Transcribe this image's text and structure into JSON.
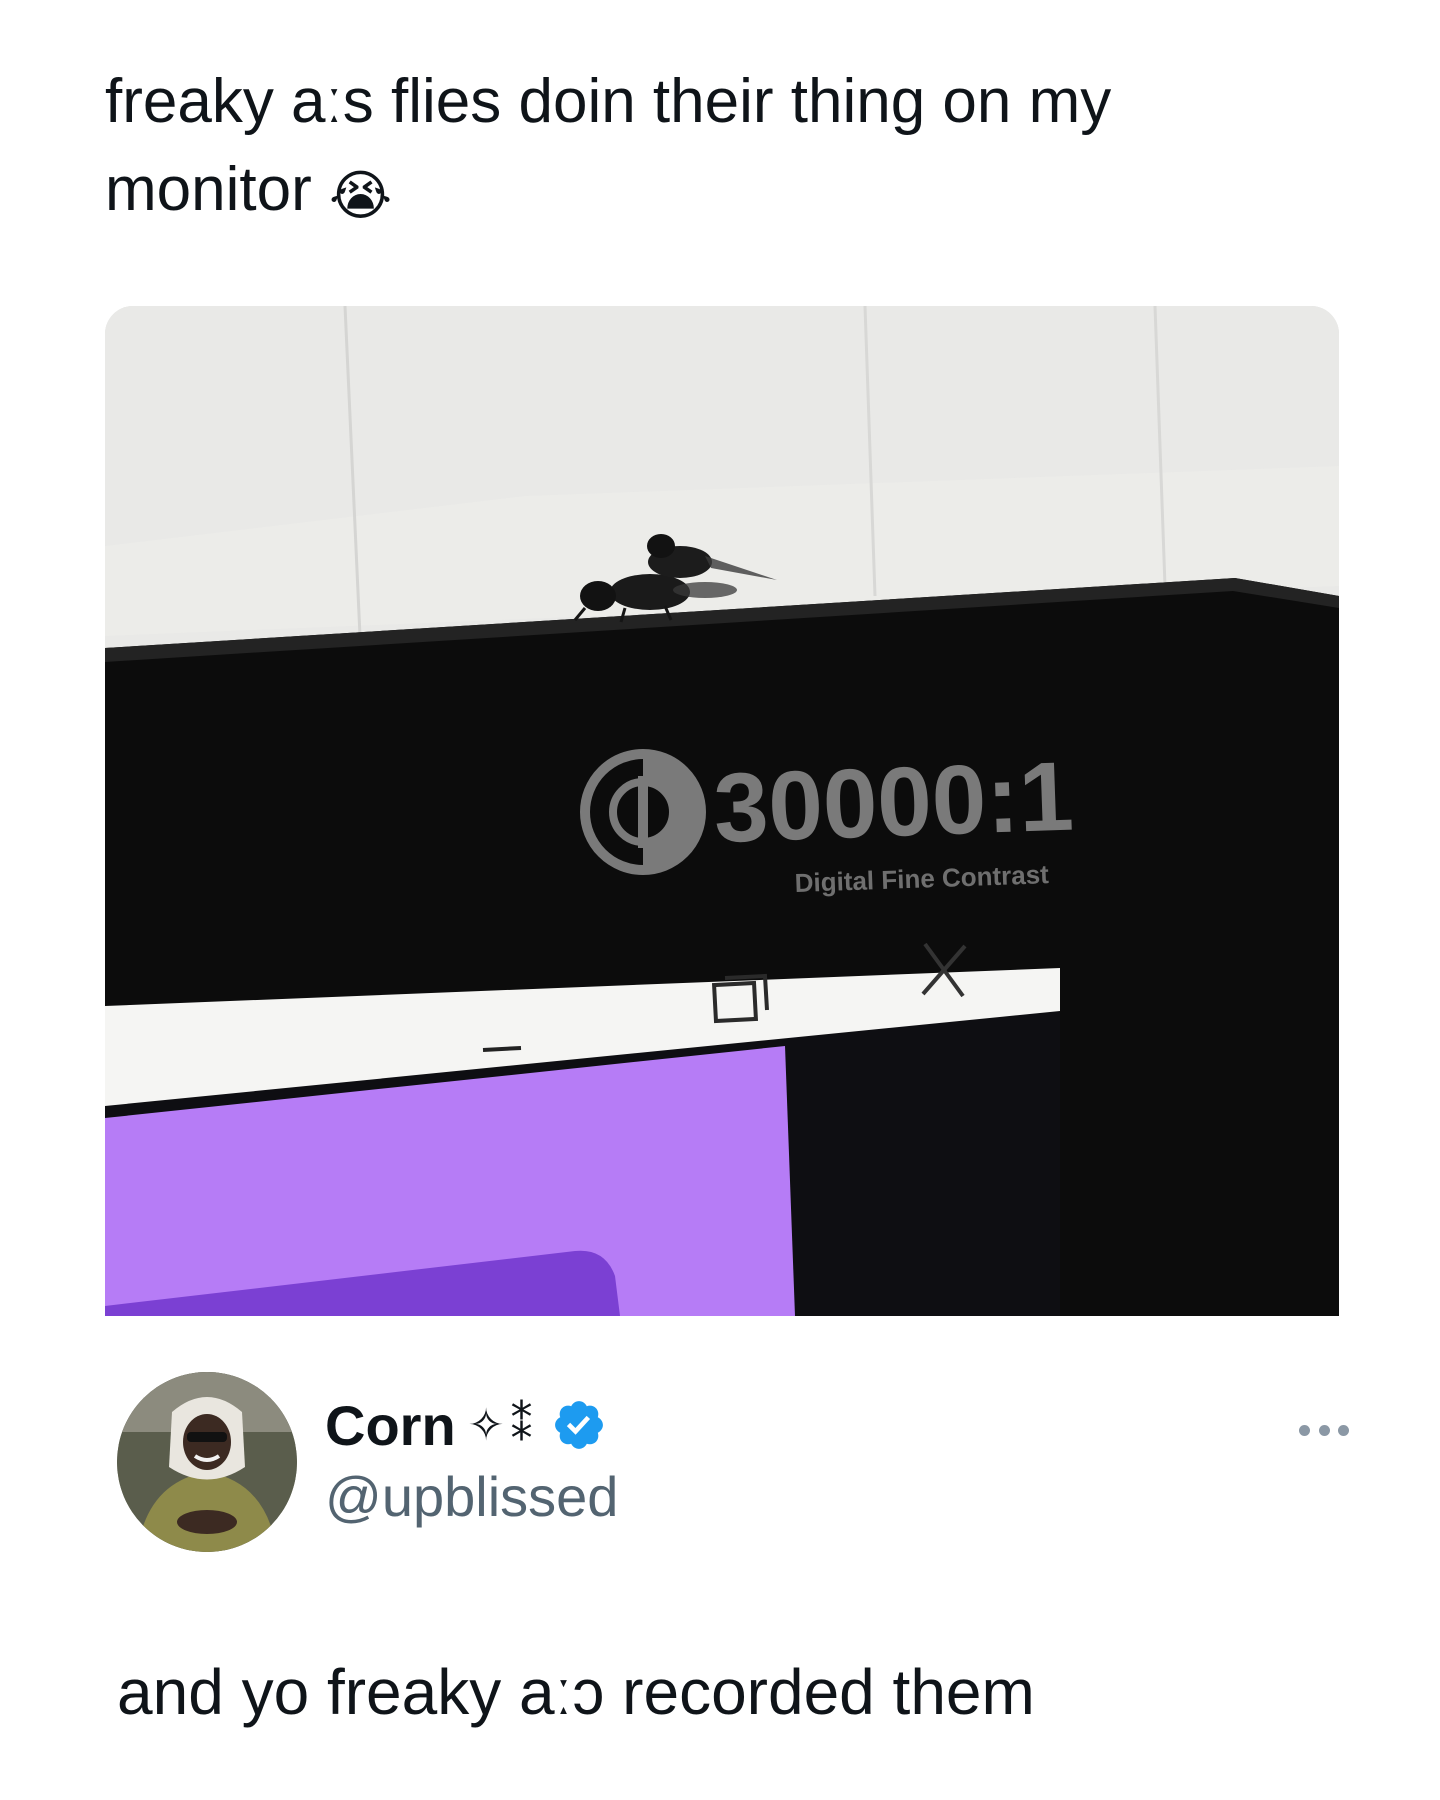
{
  "quoted_tweet": {
    "text": "freaky aːs flies doin their thing on my monitor",
    "emoji": "😭",
    "emoji_name": "loudly-crying-face-icon"
  },
  "media": {
    "monitor_brand_ratio": "30000:1",
    "monitor_brand_sub": "Digital Fine Contrast",
    "window_controls": {
      "minimize_icon": "minimize-icon",
      "restore_icon": "restore-icon",
      "close_icon": "close-icon"
    },
    "colors": {
      "wall": "#e7e7e6",
      "bezel": "#0b0b0b",
      "titlebar": "#f4f4f2",
      "window_purple": "#b57bf5",
      "window_purple_dark": "#7a3fd1"
    }
  },
  "author": {
    "display_name": "Corn",
    "name_decor": "✧⁑",
    "handle": "@upblissed",
    "verified": true,
    "verified_color": "#1d9bf0",
    "more_icon": "more-options-icon"
  },
  "reply": {
    "text": "and yo freaky aːɔ recorded them"
  }
}
